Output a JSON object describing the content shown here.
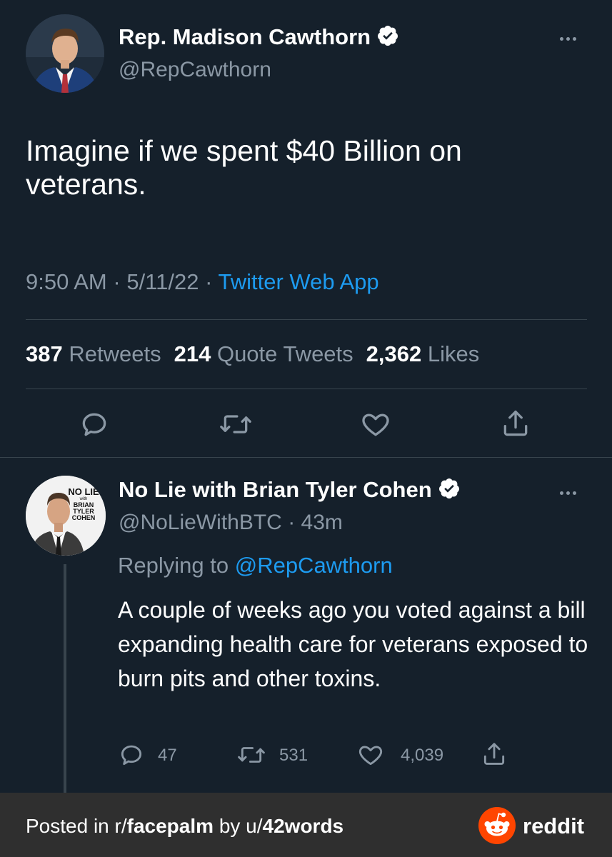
{
  "main_tweet": {
    "author_name": "Rep. Madison Cawthorn",
    "author_handle": "@RepCawthorn",
    "text": "Imagine if we spent $40 Billion on veterans.",
    "time": "9:50 AM",
    "date": "5/11/22",
    "separator": "·",
    "source": "Twitter Web App",
    "stats": {
      "retweets_count": "387",
      "retweets_label": "Retweets",
      "quotes_count": "214",
      "quotes_label": "Quote Tweets",
      "likes_count": "2,362",
      "likes_label": "Likes"
    }
  },
  "reply_tweet": {
    "author_name": "No Lie with Brian Tyler Cohen",
    "author_handle": "@NoLieWithBTC",
    "age": "43m",
    "separator": "·",
    "replying_to_label": "Replying to",
    "replying_to_handle": "@RepCawthorn",
    "text": "A couple of weeks ago you voted against a bill expanding health care for veterans exposed to burn pits and other toxins.",
    "avatar_text": {
      "line1": "NO LIE",
      "with": "with",
      "line2": "BRIAN",
      "line3": "TYLER",
      "line4": "COHEN"
    },
    "counts": {
      "replies": "47",
      "retweets": "531",
      "likes": "4,039"
    }
  },
  "footer": {
    "posted_in": "Posted in r/",
    "subreddit": "facepalm",
    "by": " by u/",
    "username": "42words",
    "brand": "reddit"
  },
  "colors": {
    "background": "#15202b",
    "accent_blue": "#1d9bf0",
    "secondary_text": "#8b98a5",
    "divider": "#38444d",
    "footer_background": "#2f2f2f",
    "reddit_orange": "#ff4500"
  },
  "icons": {
    "verified": "verified-badge-icon",
    "more": "more-options-icon",
    "reply": "reply-icon",
    "retweet": "retweet-icon",
    "like": "heart-icon",
    "share": "share-icon",
    "reddit": "reddit-alien-icon"
  }
}
